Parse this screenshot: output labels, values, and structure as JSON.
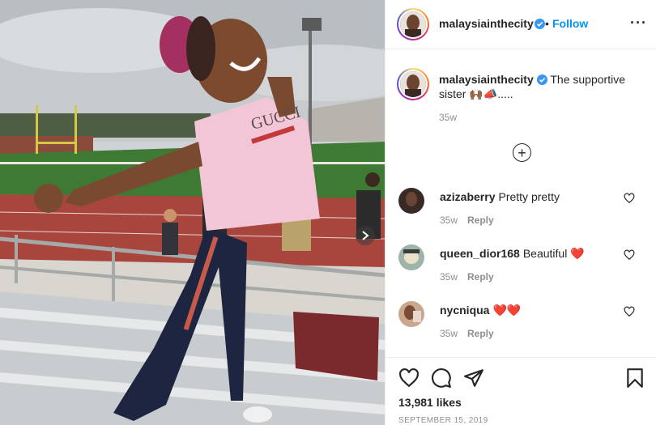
{
  "post": {
    "username": "malaysiainthecity",
    "follow_label": "Follow",
    "dot": "•",
    "more_label": "···"
  },
  "caption": {
    "username": "malaysiainthecity",
    "text": "The supportive sister 🙌🏾📣.....",
    "time": "35w"
  },
  "load_more_label": "+",
  "comments": [
    {
      "username": "azizaberry",
      "text": "Pretty pretty",
      "time": "35w",
      "reply_label": "Reply",
      "avatar_color": "#3a2a26"
    },
    {
      "username": "queen_dior168",
      "text": "Beautiful ❤️",
      "time": "35w",
      "reply_label": "Reply",
      "avatar_color": "#9fb4a8"
    },
    {
      "username": "nycniqua",
      "text": "❤️❤️",
      "time": "35w",
      "reply_label": "Reply",
      "avatar_color": "#c9a78d"
    }
  ],
  "footer": {
    "likes": "13,981 likes",
    "date": "September 15, 2019"
  },
  "icons": {
    "verified": "verified-badge-icon",
    "more": "more-options-icon",
    "load_more": "plus-circle-icon",
    "heart": "heart-icon",
    "comment": "comment-icon",
    "share": "share-icon",
    "save": "bookmark-icon",
    "next": "chevron-right-icon"
  },
  "colors": {
    "accent": "#0095f6",
    "verified": "#3897f0",
    "muted": "#8e8e8e",
    "text": "#262626"
  }
}
